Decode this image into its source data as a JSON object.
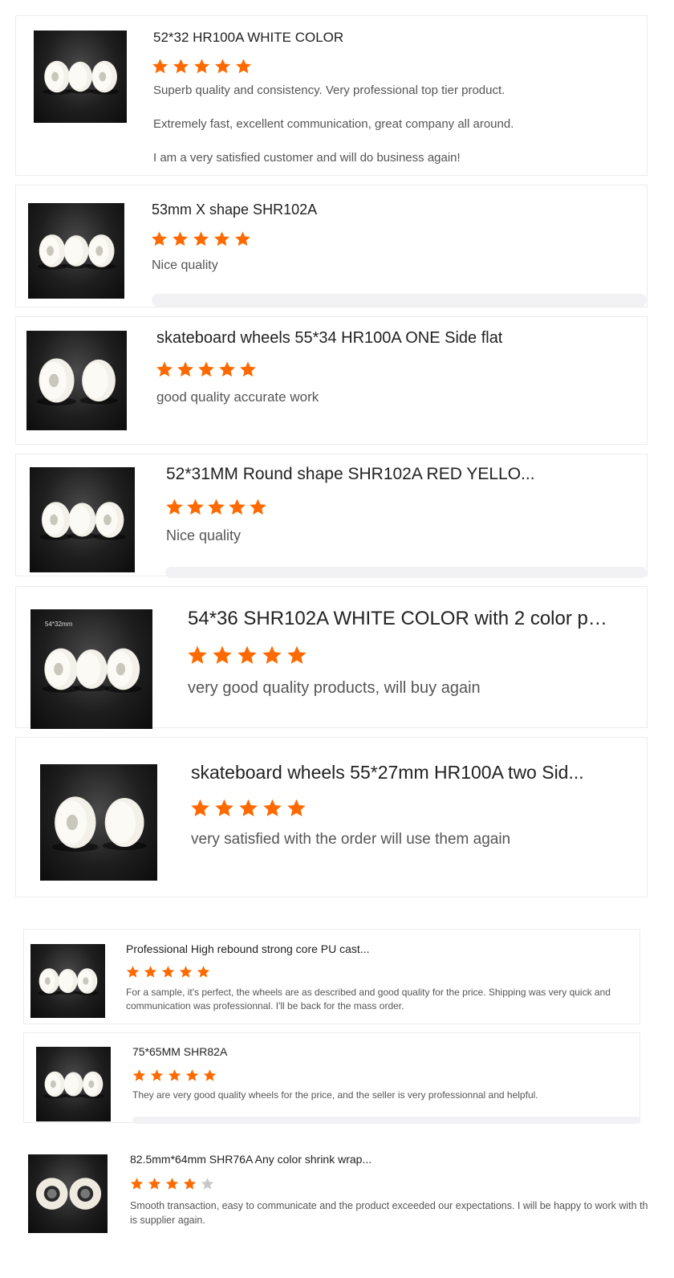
{
  "colors": {
    "star_on": "#ff6a00",
    "star_off": "#c8c8c8"
  },
  "reviews": [
    {
      "title": "52*32 HR100A WHITE COLOR",
      "rating": 5,
      "text": [
        "Superb quality and consistency. Very professional top tier product.",
        "Extremely fast, excellent communication, great company all around.",
        "I am a very satisfied customer and will do business again!"
      ]
    },
    {
      "title": "53mm X shape SHR102A",
      "rating": 5,
      "text": [
        "Nice quality"
      ]
    },
    {
      "title": "skateboard wheels 55*34 HR100A ONE Side flat",
      "rating": 5,
      "text": [
        "good quality accurate work"
      ]
    },
    {
      "title": "52*31MM Round shape SHR102A RED YELLO...",
      "rating": 5,
      "text": [
        "Nice quality"
      ]
    },
    {
      "title": "54*36 SHR102A WHITE COLOR with 2 color pri...",
      "rating": 5,
      "image_label": "54*32mm",
      "text": [
        "very good quality products, will buy again"
      ]
    },
    {
      "title": "skateboard wheels 55*27mm HR100A two Sid...",
      "rating": 5,
      "text": [
        "very satisfied with the order will use them again"
      ]
    },
    {
      "title": "Professional High rebound strong core PU cast...",
      "rating": 5,
      "text": [
        "For a sample, it's perfect, the wheels are as described and good quality for the price. Shipping was very quick and communication was professionnal. I'll be back for the mass order."
      ]
    },
    {
      "title": "75*65MM SHR82A",
      "rating": 5,
      "text": [
        "They are very good quality wheels for the price, and the seller is very professionnal and helpful."
      ]
    },
    {
      "title": "82.5mm*64mm SHR76A Any color shrink wrap...",
      "rating": 4,
      "text": [
        "Smooth transaction, easy to communicate and the product exceeded our expectations. I will be happy to work with this supplier again."
      ]
    }
  ]
}
